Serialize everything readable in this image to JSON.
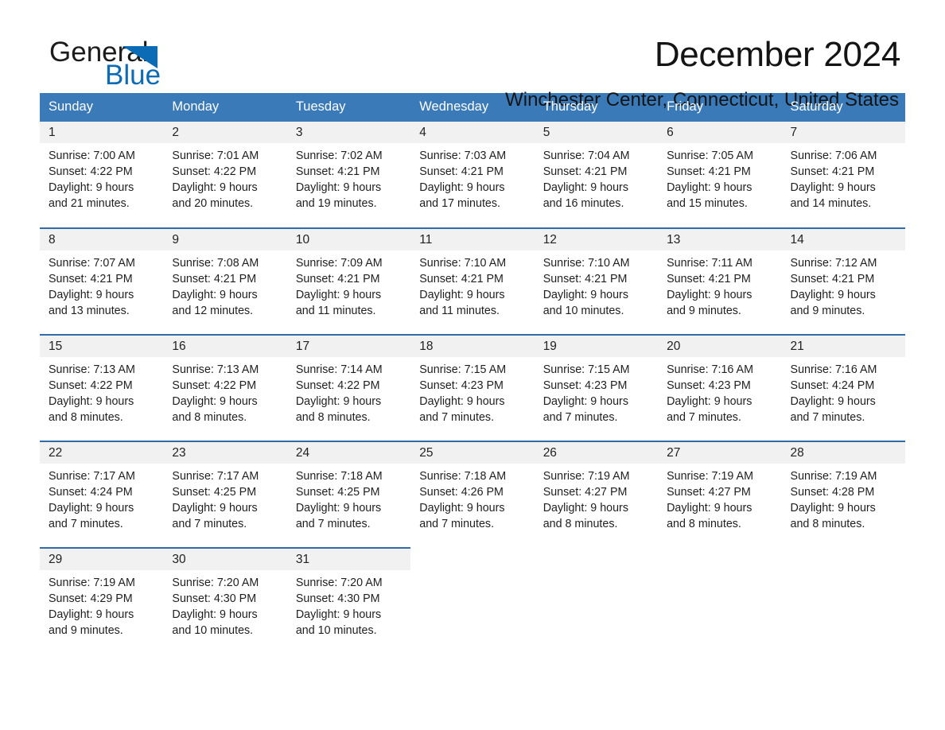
{
  "brand": {
    "name_part1": "General",
    "name_part2": "Blue",
    "triangle_color": "#0b6cb5",
    "blue_text_color": "#0b6cb5"
  },
  "header": {
    "month_title": "December 2024",
    "location": "Winchester Center, Connecticut, United States"
  },
  "theme": {
    "header_row_bg": "#3a7ab8",
    "row_divider": "#2f6ca8",
    "daynum_bg": "#f1f1f1"
  },
  "calendar": {
    "weekday_headers": [
      "Sunday",
      "Monday",
      "Tuesday",
      "Wednesday",
      "Thursday",
      "Friday",
      "Saturday"
    ],
    "weeks": [
      [
        {
          "day": "1",
          "sunrise": "Sunrise: 7:00 AM",
          "sunset": "Sunset: 4:22 PM",
          "daylight_line1": "Daylight: 9 hours",
          "daylight_line2": "and 21 minutes."
        },
        {
          "day": "2",
          "sunrise": "Sunrise: 7:01 AM",
          "sunset": "Sunset: 4:22 PM",
          "daylight_line1": "Daylight: 9 hours",
          "daylight_line2": "and 20 minutes."
        },
        {
          "day": "3",
          "sunrise": "Sunrise: 7:02 AM",
          "sunset": "Sunset: 4:21 PM",
          "daylight_line1": "Daylight: 9 hours",
          "daylight_line2": "and 19 minutes."
        },
        {
          "day": "4",
          "sunrise": "Sunrise: 7:03 AM",
          "sunset": "Sunset: 4:21 PM",
          "daylight_line1": "Daylight: 9 hours",
          "daylight_line2": "and 17 minutes."
        },
        {
          "day": "5",
          "sunrise": "Sunrise: 7:04 AM",
          "sunset": "Sunset: 4:21 PM",
          "daylight_line1": "Daylight: 9 hours",
          "daylight_line2": "and 16 minutes."
        },
        {
          "day": "6",
          "sunrise": "Sunrise: 7:05 AM",
          "sunset": "Sunset: 4:21 PM",
          "daylight_line1": "Daylight: 9 hours",
          "daylight_line2": "and 15 minutes."
        },
        {
          "day": "7",
          "sunrise": "Sunrise: 7:06 AM",
          "sunset": "Sunset: 4:21 PM",
          "daylight_line1": "Daylight: 9 hours",
          "daylight_line2": "and 14 minutes."
        }
      ],
      [
        {
          "day": "8",
          "sunrise": "Sunrise: 7:07 AM",
          "sunset": "Sunset: 4:21 PM",
          "daylight_line1": "Daylight: 9 hours",
          "daylight_line2": "and 13 minutes."
        },
        {
          "day": "9",
          "sunrise": "Sunrise: 7:08 AM",
          "sunset": "Sunset: 4:21 PM",
          "daylight_line1": "Daylight: 9 hours",
          "daylight_line2": "and 12 minutes."
        },
        {
          "day": "10",
          "sunrise": "Sunrise: 7:09 AM",
          "sunset": "Sunset: 4:21 PM",
          "daylight_line1": "Daylight: 9 hours",
          "daylight_line2": "and 11 minutes."
        },
        {
          "day": "11",
          "sunrise": "Sunrise: 7:10 AM",
          "sunset": "Sunset: 4:21 PM",
          "daylight_line1": "Daylight: 9 hours",
          "daylight_line2": "and 11 minutes."
        },
        {
          "day": "12",
          "sunrise": "Sunrise: 7:10 AM",
          "sunset": "Sunset: 4:21 PM",
          "daylight_line1": "Daylight: 9 hours",
          "daylight_line2": "and 10 minutes."
        },
        {
          "day": "13",
          "sunrise": "Sunrise: 7:11 AM",
          "sunset": "Sunset: 4:21 PM",
          "daylight_line1": "Daylight: 9 hours",
          "daylight_line2": "and 9 minutes."
        },
        {
          "day": "14",
          "sunrise": "Sunrise: 7:12 AM",
          "sunset": "Sunset: 4:21 PM",
          "daylight_line1": "Daylight: 9 hours",
          "daylight_line2": "and 9 minutes."
        }
      ],
      [
        {
          "day": "15",
          "sunrise": "Sunrise: 7:13 AM",
          "sunset": "Sunset: 4:22 PM",
          "daylight_line1": "Daylight: 9 hours",
          "daylight_line2": "and 8 minutes."
        },
        {
          "day": "16",
          "sunrise": "Sunrise: 7:13 AM",
          "sunset": "Sunset: 4:22 PM",
          "daylight_line1": "Daylight: 9 hours",
          "daylight_line2": "and 8 minutes."
        },
        {
          "day": "17",
          "sunrise": "Sunrise: 7:14 AM",
          "sunset": "Sunset: 4:22 PM",
          "daylight_line1": "Daylight: 9 hours",
          "daylight_line2": "and 8 minutes."
        },
        {
          "day": "18",
          "sunrise": "Sunrise: 7:15 AM",
          "sunset": "Sunset: 4:23 PM",
          "daylight_line1": "Daylight: 9 hours",
          "daylight_line2": "and 7 minutes."
        },
        {
          "day": "19",
          "sunrise": "Sunrise: 7:15 AM",
          "sunset": "Sunset: 4:23 PM",
          "daylight_line1": "Daylight: 9 hours",
          "daylight_line2": "and 7 minutes."
        },
        {
          "day": "20",
          "sunrise": "Sunrise: 7:16 AM",
          "sunset": "Sunset: 4:23 PM",
          "daylight_line1": "Daylight: 9 hours",
          "daylight_line2": "and 7 minutes."
        },
        {
          "day": "21",
          "sunrise": "Sunrise: 7:16 AM",
          "sunset": "Sunset: 4:24 PM",
          "daylight_line1": "Daylight: 9 hours",
          "daylight_line2": "and 7 minutes."
        }
      ],
      [
        {
          "day": "22",
          "sunrise": "Sunrise: 7:17 AM",
          "sunset": "Sunset: 4:24 PM",
          "daylight_line1": "Daylight: 9 hours",
          "daylight_line2": "and 7 minutes."
        },
        {
          "day": "23",
          "sunrise": "Sunrise: 7:17 AM",
          "sunset": "Sunset: 4:25 PM",
          "daylight_line1": "Daylight: 9 hours",
          "daylight_line2": "and 7 minutes."
        },
        {
          "day": "24",
          "sunrise": "Sunrise: 7:18 AM",
          "sunset": "Sunset: 4:25 PM",
          "daylight_line1": "Daylight: 9 hours",
          "daylight_line2": "and 7 minutes."
        },
        {
          "day": "25",
          "sunrise": "Sunrise: 7:18 AM",
          "sunset": "Sunset: 4:26 PM",
          "daylight_line1": "Daylight: 9 hours",
          "daylight_line2": "and 7 minutes."
        },
        {
          "day": "26",
          "sunrise": "Sunrise: 7:19 AM",
          "sunset": "Sunset: 4:27 PM",
          "daylight_line1": "Daylight: 9 hours",
          "daylight_line2": "and 8 minutes."
        },
        {
          "day": "27",
          "sunrise": "Sunrise: 7:19 AM",
          "sunset": "Sunset: 4:27 PM",
          "daylight_line1": "Daylight: 9 hours",
          "daylight_line2": "and 8 minutes."
        },
        {
          "day": "28",
          "sunrise": "Sunrise: 7:19 AM",
          "sunset": "Sunset: 4:28 PM",
          "daylight_line1": "Daylight: 9 hours",
          "daylight_line2": "and 8 minutes."
        }
      ],
      [
        {
          "day": "29",
          "sunrise": "Sunrise: 7:19 AM",
          "sunset": "Sunset: 4:29 PM",
          "daylight_line1": "Daylight: 9 hours",
          "daylight_line2": "and 9 minutes."
        },
        {
          "day": "30",
          "sunrise": "Sunrise: 7:20 AM",
          "sunset": "Sunset: 4:30 PM",
          "daylight_line1": "Daylight: 9 hours",
          "daylight_line2": "and 10 minutes."
        },
        {
          "day": "31",
          "sunrise": "Sunrise: 7:20 AM",
          "sunset": "Sunset: 4:30 PM",
          "daylight_line1": "Daylight: 9 hours",
          "daylight_line2": "and 10 minutes."
        },
        {
          "day": "",
          "sunrise": "",
          "sunset": "",
          "daylight_line1": "",
          "daylight_line2": ""
        },
        {
          "day": "",
          "sunrise": "",
          "sunset": "",
          "daylight_line1": "",
          "daylight_line2": ""
        },
        {
          "day": "",
          "sunrise": "",
          "sunset": "",
          "daylight_line1": "",
          "daylight_line2": ""
        },
        {
          "day": "",
          "sunrise": "",
          "sunset": "",
          "daylight_line1": "",
          "daylight_line2": ""
        }
      ]
    ]
  }
}
